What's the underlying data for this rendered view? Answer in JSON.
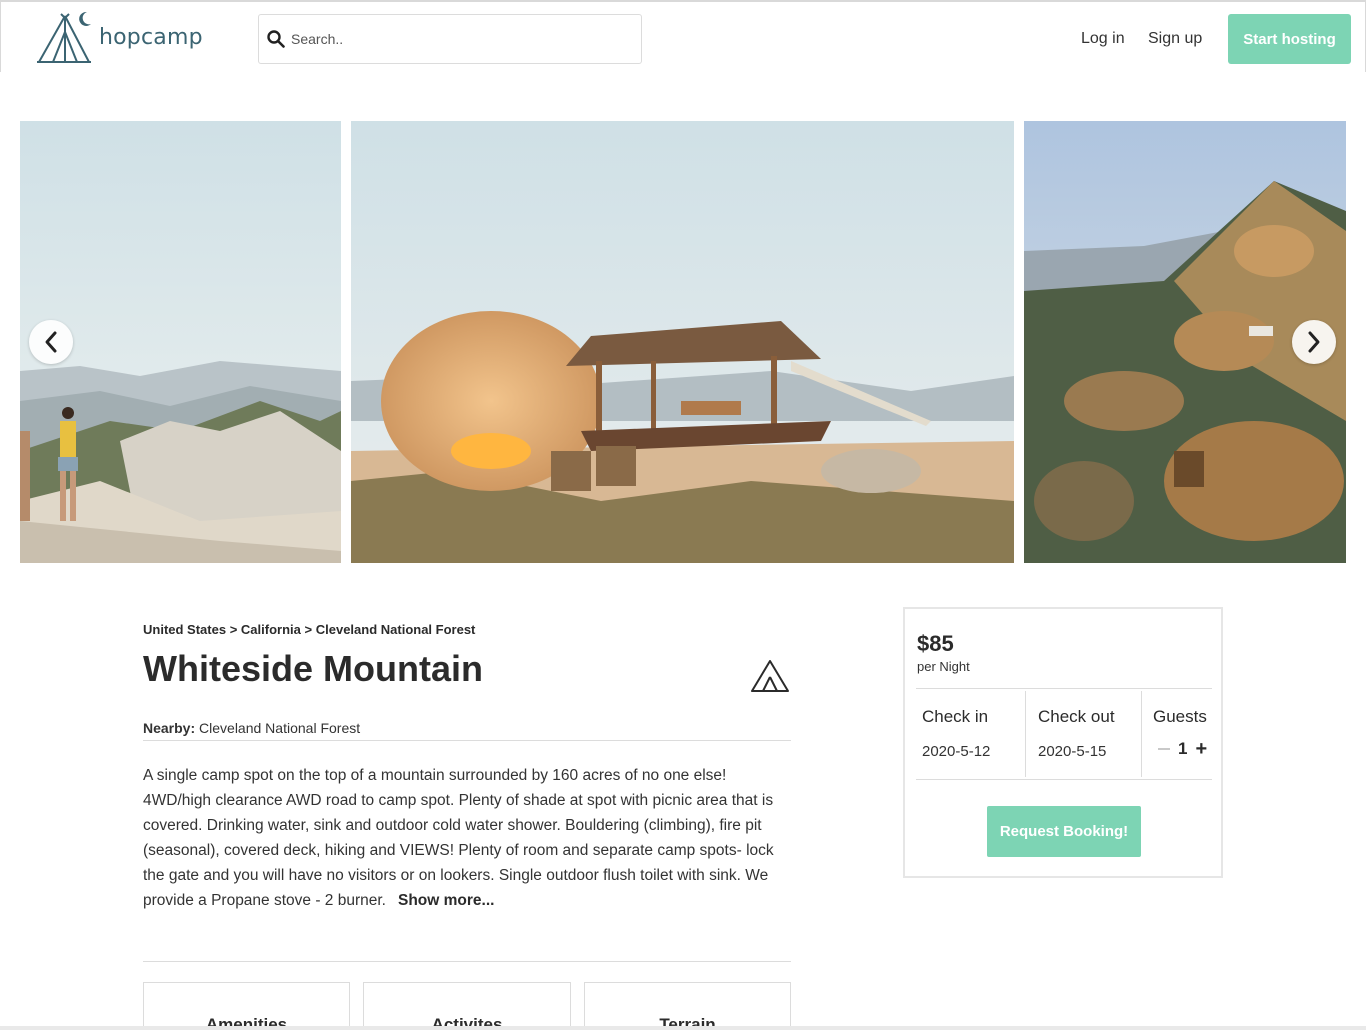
{
  "header": {
    "brand": "hopcamp",
    "search_placeholder": "Search..",
    "login_label": "Log in",
    "signup_label": "Sign up",
    "host_label": "Start hosting"
  },
  "breadcrumb": [
    "United States",
    "California",
    "Cleveland National Forest"
  ],
  "listing": {
    "title": "Whiteside Mountain",
    "nearby_label": "Nearby:",
    "nearby_value": "Cleveland National Forest",
    "description": "A single camp spot on the top of a mountain surrounded by 160 acres of no one else! 4WD/high clearance AWD road to camp spot. Plenty of shade at spot with picnic area that is covered. Drinking water, sink and outdoor cold water shower. Bouldering (climbing), fire pit (seasonal), covered deck, hiking and VIEWS! Plenty of room and separate camp spots- lock the gate and you will have no visitors or on lookers. Single outdoor flush toilet with sink. We provide a Propane stove - 2 burner.",
    "show_more": "Show more...",
    "tabs": [
      "Amenities",
      "Activites",
      "Terrain"
    ]
  },
  "booking": {
    "price": "$85",
    "per_night": "per Night",
    "check_in_label": "Check in",
    "check_in_value": "2020-5-12",
    "check_out_label": "Check out",
    "check_out_value": "2020-5-15",
    "guests_label": "Guests",
    "guests_value": "1",
    "request_label": "Request Booking!"
  },
  "colors": {
    "accent": "#7dd4b4",
    "logo": "#3b6472"
  },
  "icons": [
    "tent-logo-icon",
    "search-icon",
    "chevron-left-icon",
    "chevron-right-icon",
    "tent-outline-icon"
  ]
}
